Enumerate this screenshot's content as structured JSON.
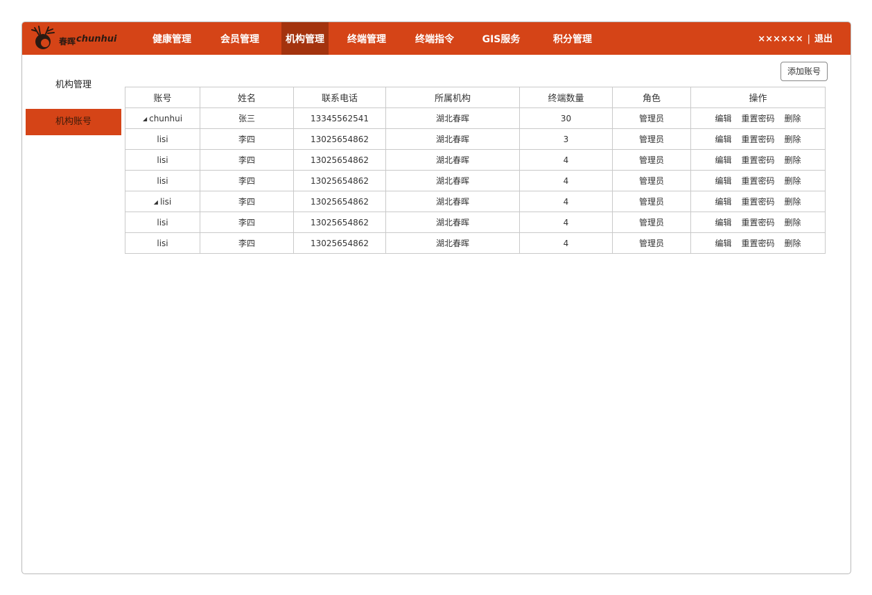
{
  "brand": {
    "cn": "春晖",
    "en": "chunhui"
  },
  "nav": [
    {
      "label": "健康管理"
    },
    {
      "label": "会员管理"
    },
    {
      "label": "机构管理"
    },
    {
      "label": "终端管理"
    },
    {
      "label": "终端指令"
    },
    {
      "label": "GIS服务"
    },
    {
      "label": "积分管理"
    }
  ],
  "nav_active_index": 2,
  "user": {
    "name": "××××××",
    "separator": "|",
    "logout": "退出"
  },
  "sidebar": [
    {
      "label": "机构管理"
    },
    {
      "label": "机构账号"
    }
  ],
  "sidebar_active_index": 1,
  "add_button": "添加账号",
  "table": {
    "headers": [
      "账号",
      "姓名",
      "联系电话",
      "所属机构",
      "终端数量",
      "角色",
      "操作"
    ],
    "actions": [
      "编辑",
      "重置密码",
      "删除"
    ],
    "rows": [
      {
        "account": "chunhui",
        "expand": "◢",
        "name": "张三",
        "phone": "13345562541",
        "org": "湖北春晖",
        "terminals": "30",
        "role": "管理员"
      },
      {
        "account": "lisi",
        "name": "李四",
        "phone": "13025654862",
        "org": "湖北春晖",
        "terminals": "3",
        "role": "管理员"
      },
      {
        "account": "lisi",
        "name": "李四",
        "phone": "13025654862",
        "org": "湖北春晖",
        "terminals": "4",
        "role": "管理员"
      },
      {
        "account": "lisi",
        "name": "李四",
        "phone": "13025654862",
        "org": "湖北春晖",
        "terminals": "4",
        "role": "管理员"
      },
      {
        "account": "lisi",
        "expand": "◢",
        "name": "李四",
        "phone": "13025654862",
        "org": "湖北春晖",
        "terminals": "4",
        "role": "管理员"
      },
      {
        "account": "lisi",
        "name": "李四",
        "phone": "13025654862",
        "org": "湖北春晖",
        "terminals": "4",
        "role": "管理员"
      },
      {
        "account": "lisi",
        "name": "李四",
        "phone": "13025654862",
        "org": "湖北春晖",
        "terminals": "4",
        "role": "管理员"
      }
    ]
  },
  "colors": {
    "accent": "#d54417",
    "accent_dark": "#a3330e",
    "border": "#c9c9c9"
  }
}
